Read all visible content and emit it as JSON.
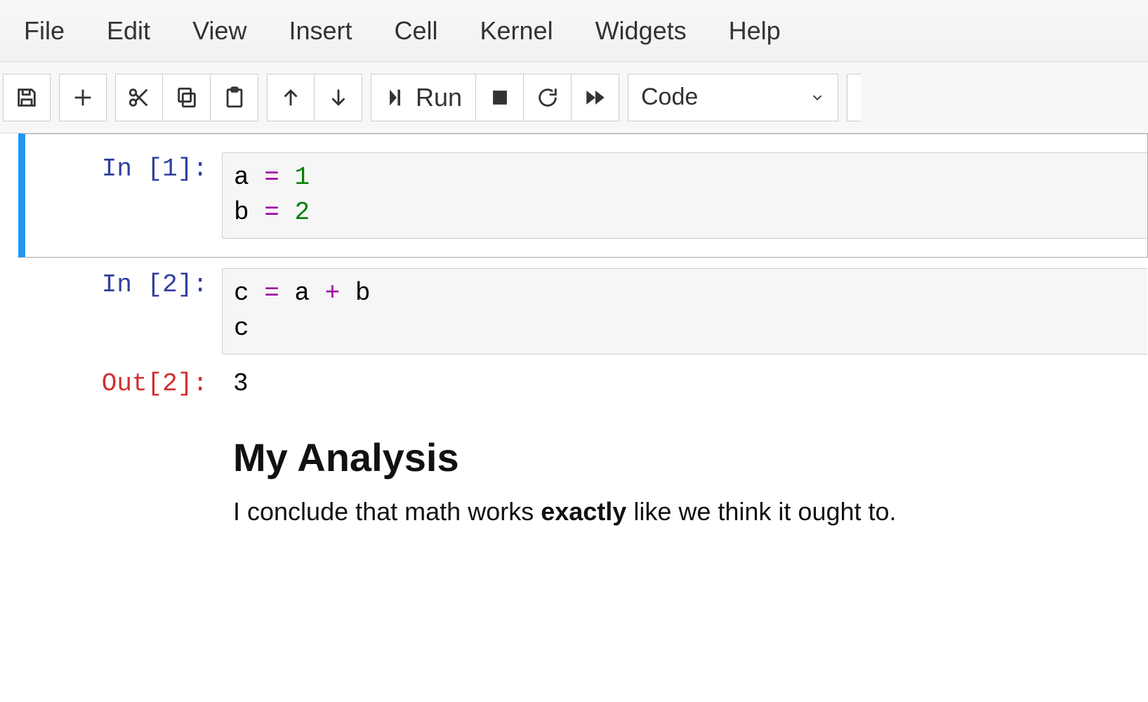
{
  "menu": {
    "file": "File",
    "edit": "Edit",
    "view": "View",
    "insert": "Insert",
    "cell": "Cell",
    "kernel": "Kernel",
    "widgets": "Widgets",
    "help": "Help"
  },
  "toolbar": {
    "run_label": "Run",
    "celltype_value": "Code"
  },
  "cells": [
    {
      "prompt": "In [1]:",
      "code_tokens": [
        {
          "t": "a ",
          "c": "plain"
        },
        {
          "t": "=",
          "c": "op"
        },
        {
          "t": " ",
          "c": "plain"
        },
        {
          "t": "1",
          "c": "num"
        },
        {
          "t": "\n",
          "c": "plain"
        },
        {
          "t": "b ",
          "c": "plain"
        },
        {
          "t": "=",
          "c": "op"
        },
        {
          "t": " ",
          "c": "plain"
        },
        {
          "t": "2",
          "c": "num"
        }
      ]
    },
    {
      "prompt": "In [2]:",
      "code_tokens": [
        {
          "t": "c ",
          "c": "plain"
        },
        {
          "t": "=",
          "c": "op"
        },
        {
          "t": " a ",
          "c": "plain"
        },
        {
          "t": "+",
          "c": "op"
        },
        {
          "t": " b",
          "c": "plain"
        },
        {
          "t": "\n",
          "c": "plain"
        },
        {
          "t": "c",
          "c": "plain"
        }
      ],
      "out_prompt": "Out[2]:",
      "out_text": "3"
    }
  ],
  "markdown": {
    "heading": "My Analysis",
    "para_pre": "I conclude that math works ",
    "para_bold": "exactly",
    "para_post": " like we think it ought to."
  }
}
